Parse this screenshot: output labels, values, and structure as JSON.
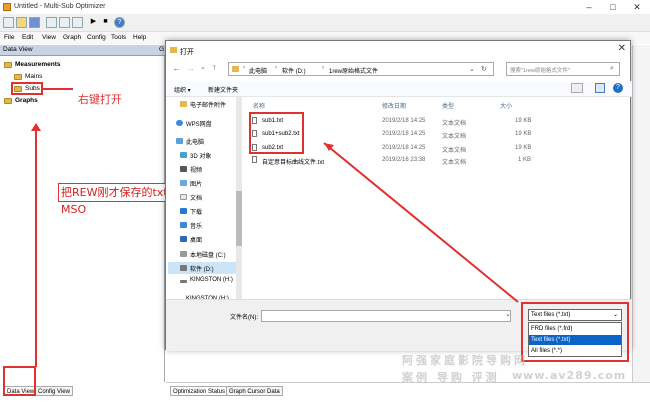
{
  "app": {
    "title": "Untitled - Multi-Sub Optimizer",
    "window_controls": [
      "–",
      "□",
      "✕"
    ],
    "menu": [
      "File",
      "Edit",
      "View",
      "Graph",
      "Config",
      "Tools",
      "Help"
    ],
    "panel_title": "Data View",
    "panel_title_right": "G",
    "tree": {
      "measurements": "Measurements",
      "mains": "Mains",
      "subs": "Subs",
      "graphs": "Graphs"
    },
    "left_tabs": [
      "Data View",
      "Config View"
    ],
    "bottom_tabs": [
      "Optimization Status",
      "Graph Cursor Data"
    ]
  },
  "dialog": {
    "title": "打开",
    "breadcrumb": [
      "此电脑",
      "软件 (D:)",
      "1rew原始格式文件"
    ],
    "search_placeholder": "搜索\"1rew原始格式文件\"",
    "organize": "组织 ▾",
    "new_folder": "新建文件夹",
    "nav_items": [
      "电子邮件附件",
      "WPS网盘",
      "此电脑",
      "3D 对象",
      "视频",
      "图片",
      "文档",
      "下载",
      "音乐",
      "桌面",
      "本地磁盘 (C:)",
      "软件 (D:)",
      "KINGSTON (H:)",
      "KINGSTON (H:)"
    ],
    "columns": [
      "名称",
      "修改日期",
      "类型",
      "大小"
    ],
    "files": [
      {
        "name": "sub1.txt",
        "date": "2019/2/18 14:25",
        "type": "文本文档",
        "size": "19 KB"
      },
      {
        "name": "sub1+sub2.txt",
        "date": "2019/2/18 14:25",
        "type": "文本文档",
        "size": "19 KB"
      },
      {
        "name": "sub2.txt",
        "date": "2019/2/18 14:25",
        "type": "文本文档",
        "size": "19 KB"
      },
      {
        "name": "自定意目标曲线文件.txt",
        "date": "2019/2/16 23:38",
        "type": "文本文档",
        "size": "1 KB"
      }
    ],
    "filename_label": "文件名(N):",
    "filetype_selected": "Text files (*.txt)",
    "filetype_options": [
      "FRD files (*.frd)",
      "Text files (*.txt)",
      "All files (*.*)"
    ]
  },
  "annotations": {
    "right_click": "右键打开",
    "import_note": "把REW刚才保存的txt文件导入MSO"
  },
  "watermark": {
    "line1": "阿强家庭影院导购网",
    "line2": "案例 导购 评测",
    "line3": "www.av289.com"
  },
  "colors": {
    "annotation_red": "#e0312e",
    "selection_blue": "#0a64c8",
    "folder_yellow": "#e6b84c"
  }
}
